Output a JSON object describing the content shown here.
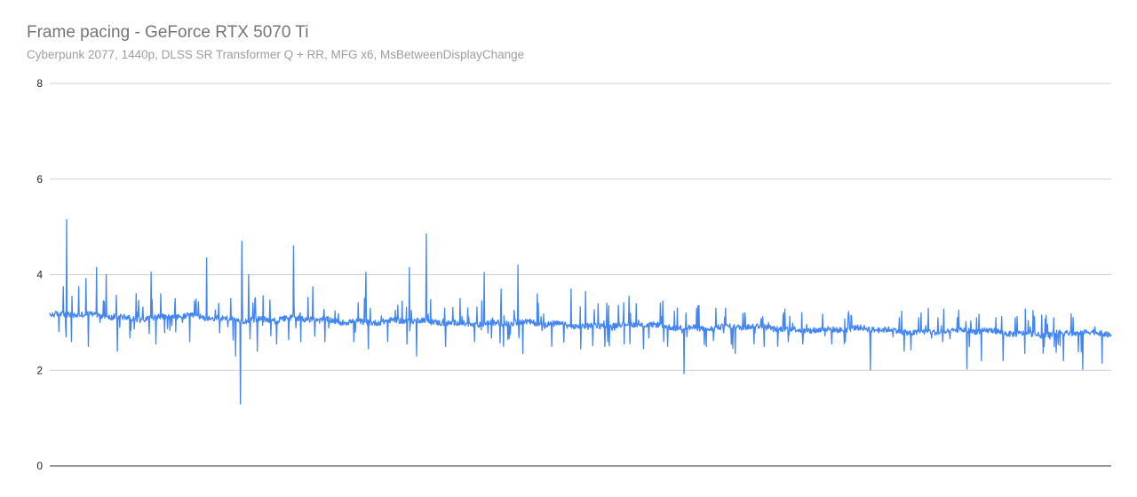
{
  "chart_data": {
    "type": "line",
    "title": "Frame pacing - GeForce RTX 5070 Ti",
    "subtitle": "Cyberpunk 2077, 1440p, DLSS SR Transformer Q + RR, MFG x6, MsBetweenDisplayChange",
    "xlabel": "",
    "ylabel": "",
    "ylim": [
      0,
      8
    ],
    "yticks": [
      "0",
      "2",
      "4",
      "6",
      "8"
    ],
    "grid": true,
    "legend": "none",
    "series_color": "#4285f4",
    "sample_count": 2200,
    "trend": {
      "start": 3.15,
      "end": 2.75
    },
    "noise_amplitude": 0.06,
    "spikes": [
      {
        "x": 35,
        "y": 5.15
      },
      {
        "x": 28,
        "y": 3.75
      },
      {
        "x": 46,
        "y": 3.55
      },
      {
        "x": 60,
        "y": 3.75
      },
      {
        "x": 75,
        "y": 3.92
      },
      {
        "x": 97,
        "y": 4.15
      },
      {
        "x": 117,
        "y": 4.0
      },
      {
        "x": 140,
        "y": 3.3
      },
      {
        "x": 210,
        "y": 4.05
      },
      {
        "x": 230,
        "y": 3.6
      },
      {
        "x": 260,
        "y": 3.5
      },
      {
        "x": 300,
        "y": 3.45
      },
      {
        "x": 325,
        "y": 4.35
      },
      {
        "x": 350,
        "y": 3.4
      },
      {
        "x": 375,
        "y": 3.5
      },
      {
        "x": 398,
        "y": 4.7
      },
      {
        "x": 412,
        "y": 4.0
      },
      {
        "x": 425,
        "y": 3.5
      },
      {
        "x": 470,
        "y": 3.6
      },
      {
        "x": 505,
        "y": 4.6
      },
      {
        "x": 520,
        "y": 3.6
      },
      {
        "x": 545,
        "y": 3.75
      },
      {
        "x": 570,
        "y": 3.5
      },
      {
        "x": 630,
        "y": 4.45
      },
      {
        "x": 655,
        "y": 4.05
      },
      {
        "x": 660,
        "y": 3.75
      },
      {
        "x": 700,
        "y": 3.5
      },
      {
        "x": 745,
        "y": 4.15
      },
      {
        "x": 760,
        "y": 4.0
      },
      {
        "x": 780,
        "y": 4.85
      },
      {
        "x": 820,
        "y": 3.6
      },
      {
        "x": 850,
        "y": 3.5
      },
      {
        "x": 900,
        "y": 4.05
      },
      {
        "x": 935,
        "y": 3.7
      },
      {
        "x": 970,
        "y": 4.2
      },
      {
        "x": 1010,
        "y": 3.6
      },
      {
        "x": 1040,
        "y": 3.5
      },
      {
        "x": 1080,
        "y": 3.7
      },
      {
        "x": 1110,
        "y": 3.65
      },
      {
        "x": 1150,
        "y": 3.5
      },
      {
        "x": 1200,
        "y": 3.55
      },
      {
        "x": 1230,
        "y": 3.45
      },
      {
        "x": 1270,
        "y": 3.45
      },
      {
        "x": 1300,
        "y": 3.3
      },
      {
        "x": 1340,
        "y": 3.3
      },
      {
        "x": 1380,
        "y": 3.3
      },
      {
        "x": 1400,
        "y": 3.3
      },
      {
        "x": 1440,
        "y": 3.2
      },
      {
        "x": 1480,
        "y": 3.2
      },
      {
        "x": 1520,
        "y": 3.2
      },
      {
        "x": 1560,
        "y": 3.2
      },
      {
        "x": 1620,
        "y": 3.15
      },
      {
        "x": 1660,
        "y": 3.15
      },
      {
        "x": 1700,
        "y": 3.15
      },
      {
        "x": 1760,
        "y": 3.1
      },
      {
        "x": 1800,
        "y": 3.1
      },
      {
        "x": 1840,
        "y": 3.1
      },
      {
        "x": 1880,
        "y": 3.1
      },
      {
        "x": 1920,
        "y": 3.1
      },
      {
        "x": 1960,
        "y": 3.1
      },
      {
        "x": 2000,
        "y": 3.1
      },
      {
        "x": 2040,
        "y": 3.1
      },
      {
        "x": 2080,
        "y": 3.1
      },
      {
        "x": 2120,
        "y": 3.1
      }
    ],
    "dips": [
      {
        "x": 45,
        "y": 2.6
      },
      {
        "x": 80,
        "y": 2.5
      },
      {
        "x": 140,
        "y": 2.4
      },
      {
        "x": 220,
        "y": 2.55
      },
      {
        "x": 290,
        "y": 2.6
      },
      {
        "x": 385,
        "y": 2.3
      },
      {
        "x": 395,
        "y": 1.3
      },
      {
        "x": 430,
        "y": 2.4
      },
      {
        "x": 470,
        "y": 2.55
      },
      {
        "x": 520,
        "y": 2.6
      },
      {
        "x": 570,
        "y": 2.6
      },
      {
        "x": 630,
        "y": 2.6
      },
      {
        "x": 660,
        "y": 2.45
      },
      {
        "x": 700,
        "y": 2.6
      },
      {
        "x": 740,
        "y": 2.55
      },
      {
        "x": 760,
        "y": 2.3
      },
      {
        "x": 820,
        "y": 2.5
      },
      {
        "x": 880,
        "y": 2.6
      },
      {
        "x": 940,
        "y": 2.5
      },
      {
        "x": 980,
        "y": 2.35
      },
      {
        "x": 1040,
        "y": 2.5
      },
      {
        "x": 1100,
        "y": 2.45
      },
      {
        "x": 1150,
        "y": 2.5
      },
      {
        "x": 1190,
        "y": 2.55
      },
      {
        "x": 1230,
        "y": 2.45
      },
      {
        "x": 1280,
        "y": 2.5
      },
      {
        "x": 1314,
        "y": 1.93
      },
      {
        "x": 1360,
        "y": 2.5
      },
      {
        "x": 1420,
        "y": 2.35
      },
      {
        "x": 1480,
        "y": 2.5
      },
      {
        "x": 1530,
        "y": 2.6
      },
      {
        "x": 1560,
        "y": 2.55
      },
      {
        "x": 1620,
        "y": 2.55
      },
      {
        "x": 1700,
        "y": 2.01
      },
      {
        "x": 1770,
        "y": 2.4
      },
      {
        "x": 1850,
        "y": 2.6
      },
      {
        "x": 1900,
        "y": 2.03
      },
      {
        "x": 1930,
        "y": 2.2
      },
      {
        "x": 1975,
        "y": 2.2
      },
      {
        "x": 2020,
        "y": 2.35
      },
      {
        "x": 2060,
        "y": 2.5
      },
      {
        "x": 2100,
        "y": 2.2
      },
      {
        "x": 2140,
        "y": 2.02
      },
      {
        "x": 2180,
        "y": 2.15
      }
    ]
  }
}
